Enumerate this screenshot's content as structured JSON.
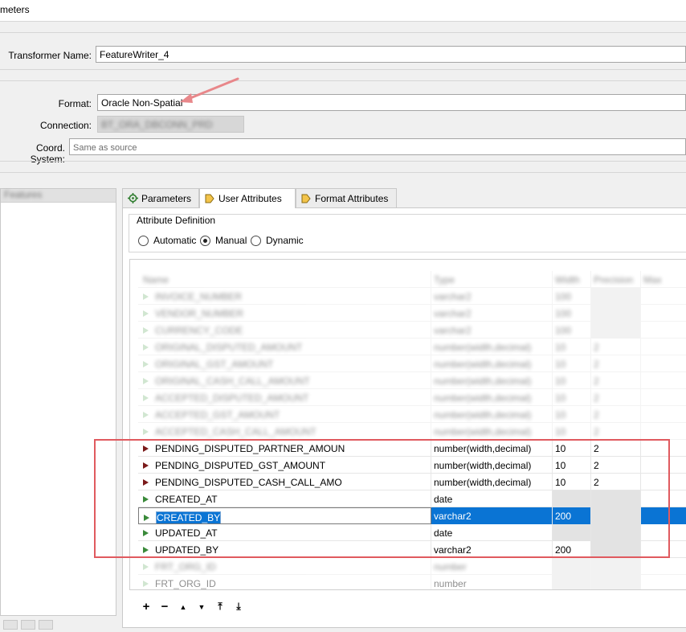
{
  "window": {
    "title": "meters"
  },
  "form": {
    "transformer_name_label": "Transformer Name:",
    "transformer_name_value": "FeatureWriter_4",
    "format_label": "Format:",
    "format_value": "Oracle Non-Spatial",
    "connection_label": "Connection:",
    "connection_value": "BT_ORA_DBCONN_PRD",
    "coord_label": "Coord. System:",
    "coord_placeholder": "Same as source"
  },
  "left_panel": {
    "header": "Features"
  },
  "tabs": [
    {
      "label": "Parameters",
      "icon": "gear-icon"
    },
    {
      "label": "User Attributes",
      "icon": "arrow-icon"
    },
    {
      "label": "Format Attributes",
      "icon": "arrow-icon"
    }
  ],
  "attribute_definition": {
    "title": "Attribute Definition",
    "options": [
      "Automatic",
      "Manual",
      "Dynamic"
    ],
    "selected": "Manual"
  },
  "table": {
    "columns": [
      "Name",
      "Type",
      "Width",
      "Precision",
      "Max"
    ],
    "faded_rows": [
      {
        "name": "INVOICE_NUMBER",
        "type": "varchar2",
        "width": "100",
        "precision": ""
      },
      {
        "name": "VENDOR_NUMBER",
        "type": "varchar2",
        "width": "100",
        "precision": ""
      },
      {
        "name": "CURRENCY_CODE",
        "type": "varchar2",
        "width": "100",
        "precision": ""
      },
      {
        "name": "ORIGINAL_DISPUTED_AMOUNT",
        "type": "number(width,decimal)",
        "width": "10",
        "precision": "2"
      },
      {
        "name": "ORIGINAL_GST_AMOUNT",
        "type": "number(width,decimal)",
        "width": "10",
        "precision": "2"
      },
      {
        "name": "ORIGINAL_CASH_CALL_AMOUNT",
        "type": "number(width,decimal)",
        "width": "10",
        "precision": "2"
      },
      {
        "name": "ACCEPTED_DISPUTED_AMOUNT",
        "type": "number(width,decimal)",
        "width": "10",
        "precision": "2"
      },
      {
        "name": "ACCEPTED_GST_AMOUNT",
        "type": "number(width,decimal)",
        "width": "10",
        "precision": "2"
      },
      {
        "name": "ACCEPTED_CASH_CALL_AMOUNT",
        "type": "number(width,decimal)",
        "width": "10",
        "precision": "2"
      }
    ],
    "rows": [
      {
        "name": "PENDING_DISPUTED_PARTNER_AMOUN",
        "type": "number(width,decimal)",
        "width": "10",
        "precision": "2"
      },
      {
        "name": "PENDING_DISPUTED_GST_AMOUNT",
        "type": "number(width,decimal)",
        "width": "10",
        "precision": "2"
      },
      {
        "name": "PENDING_DISPUTED_CASH_CALL_AMO",
        "type": "number(width,decimal)",
        "width": "10",
        "precision": "2"
      },
      {
        "name": "CREATED_AT",
        "type": "date",
        "width": "",
        "precision": ""
      },
      {
        "name": "CREATED_BY",
        "type": "varchar2",
        "width": "200",
        "precision": ""
      },
      {
        "name": "UPDATED_AT",
        "type": "date",
        "width": "",
        "precision": ""
      },
      {
        "name": "UPDATED_BY",
        "type": "varchar2",
        "width": "200",
        "precision": ""
      }
    ],
    "tail_rows": [
      {
        "name": "FRT_ORG_ID",
        "type": "number",
        "width": "",
        "precision": ""
      },
      {
        "name": "FRT_ORG_ID",
        "type": "number",
        "width": "",
        "precision": ""
      }
    ]
  },
  "toolbar": {
    "add": "+",
    "remove": "−",
    "up": "▲",
    "down": "▼",
    "top": "⤒",
    "bottom": "⤓"
  },
  "colors": {
    "selection": "#0a74d4",
    "highlight_box": "#e05a5f",
    "annotation_arrow": "#e8878a"
  }
}
